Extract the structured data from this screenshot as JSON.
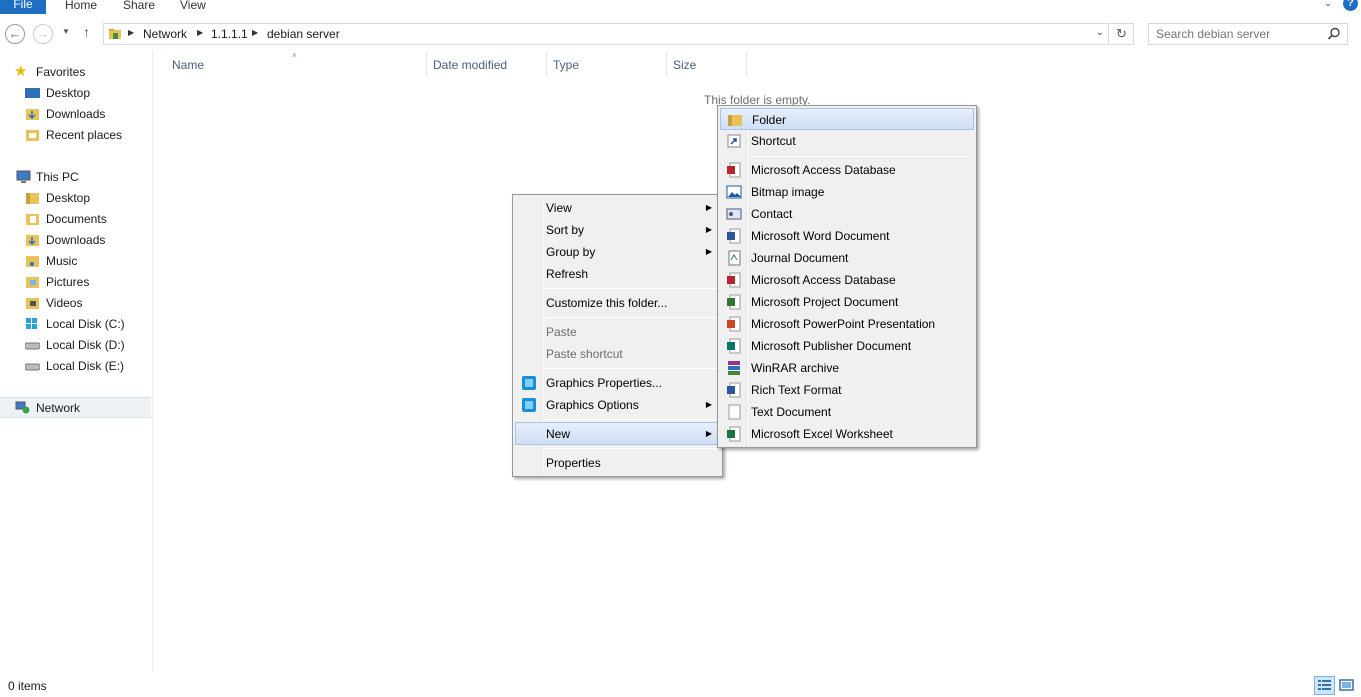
{
  "ribbon": {
    "file": "File",
    "tabs": [
      "Home",
      "Share",
      "View"
    ]
  },
  "address": {
    "crumbs": [
      "Network",
      "1.1.1.1",
      "debian server"
    ]
  },
  "search": {
    "placeholder": "Search debian server"
  },
  "nav": {
    "favorites": "Favorites",
    "favorites_items": [
      "Desktop",
      "Downloads",
      "Recent places"
    ],
    "this_pc": "This PC",
    "pc_items": [
      "Desktop",
      "Documents",
      "Downloads",
      "Music",
      "Pictures",
      "Videos",
      "Local Disk (C:)",
      "Local Disk (D:)",
      "Local Disk (E:)"
    ],
    "network": "Network"
  },
  "columns": [
    "Name",
    "Date modified",
    "Type",
    "Size"
  ],
  "content": {
    "empty_message": "This folder is empty."
  },
  "status": {
    "items": "0 items"
  },
  "context_menu": {
    "items": [
      "View",
      "Sort by",
      "Group by",
      "Refresh",
      "Customize this folder...",
      "Paste",
      "Paste shortcut",
      "Graphics Properties...",
      "Graphics Options",
      "New",
      "Properties"
    ]
  },
  "new_submenu": {
    "items": [
      "Folder",
      "Shortcut",
      "Microsoft Access Database",
      "Bitmap image",
      "Contact",
      "Microsoft Word Document",
      "Journal Document",
      "Microsoft Access Database",
      "Microsoft Project Document",
      "Microsoft PowerPoint Presentation",
      "Microsoft Publisher Document",
      "WinRAR archive",
      "Rich Text Format",
      "Text Document",
      "Microsoft Excel Worksheet"
    ]
  },
  "colors": {
    "accent": "#1e6fc2",
    "highlight": "#cfdff5"
  }
}
